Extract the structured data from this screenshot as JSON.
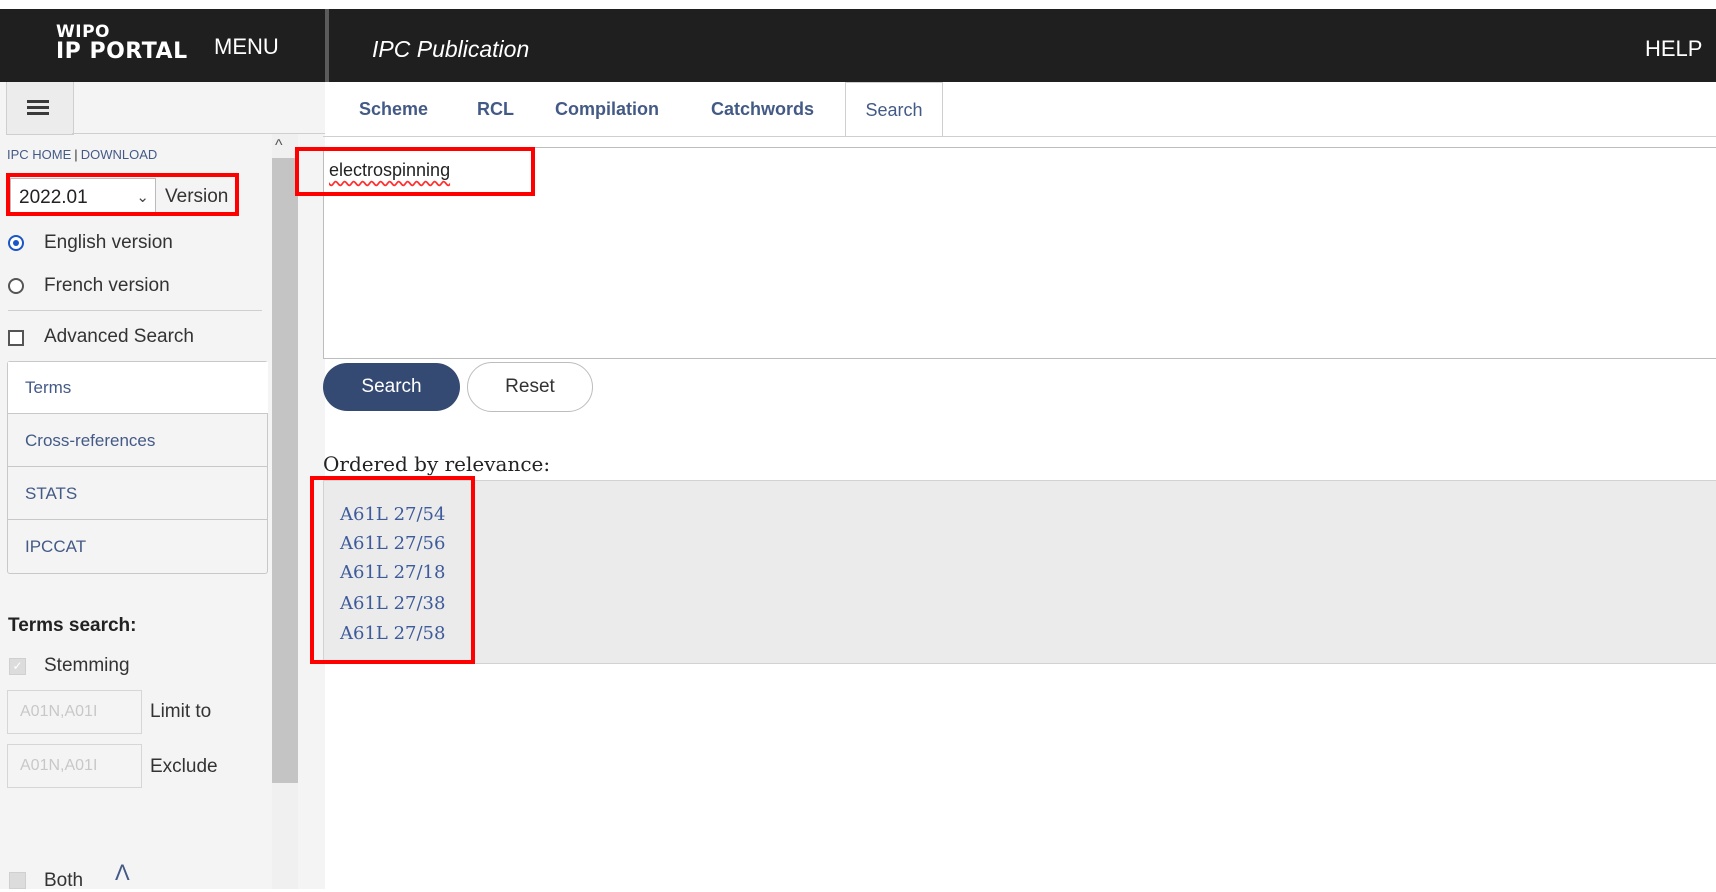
{
  "header": {
    "logo_line1": "WIPO",
    "logo_line2": "IP PORTAL",
    "menu_label": "MENU",
    "title": "IPC Publication",
    "help_label": "HELP"
  },
  "sidebar": {
    "hamburger_icon": "hamburger-icon",
    "links": {
      "home": "IPC HOME",
      "separator": "|",
      "download": "DOWNLOAD"
    },
    "version_value": "2022.01",
    "version_label": "Version",
    "language": {
      "english": "English version",
      "french": "French version",
      "selected": "english"
    },
    "advanced_search_label": "Advanced Search",
    "nav": [
      "Terms",
      "Cross-references",
      "STATS",
      "IPCCAT"
    ],
    "terms_search_title": "Terms search:",
    "stemming_label": "Stemming",
    "limit_placeholder": "A01N,A01I",
    "limit_label": "Limit to",
    "exclude_placeholder": "A01N,A01I",
    "exclude_label": "Exclude",
    "both_label": "Both"
  },
  "tabs": {
    "scheme": "Scheme",
    "rcl": "RCL",
    "compilation": "Compilation",
    "catchwords": "Catchwords",
    "search": "Search",
    "active": "search"
  },
  "search": {
    "query": "electrospinning",
    "search_button": "Search",
    "reset_button": "Reset"
  },
  "results": {
    "ordered_label": "Ordered by relevance:",
    "items": [
      "A61L 27/54",
      "A61L 27/56",
      "A61L 27/18",
      "A61L 27/38",
      "A61L 27/58"
    ]
  },
  "colors": {
    "header_bg": "#1f1f1f",
    "link": "#445a86",
    "primary_button": "#354a72",
    "highlight": "#ff0000"
  }
}
